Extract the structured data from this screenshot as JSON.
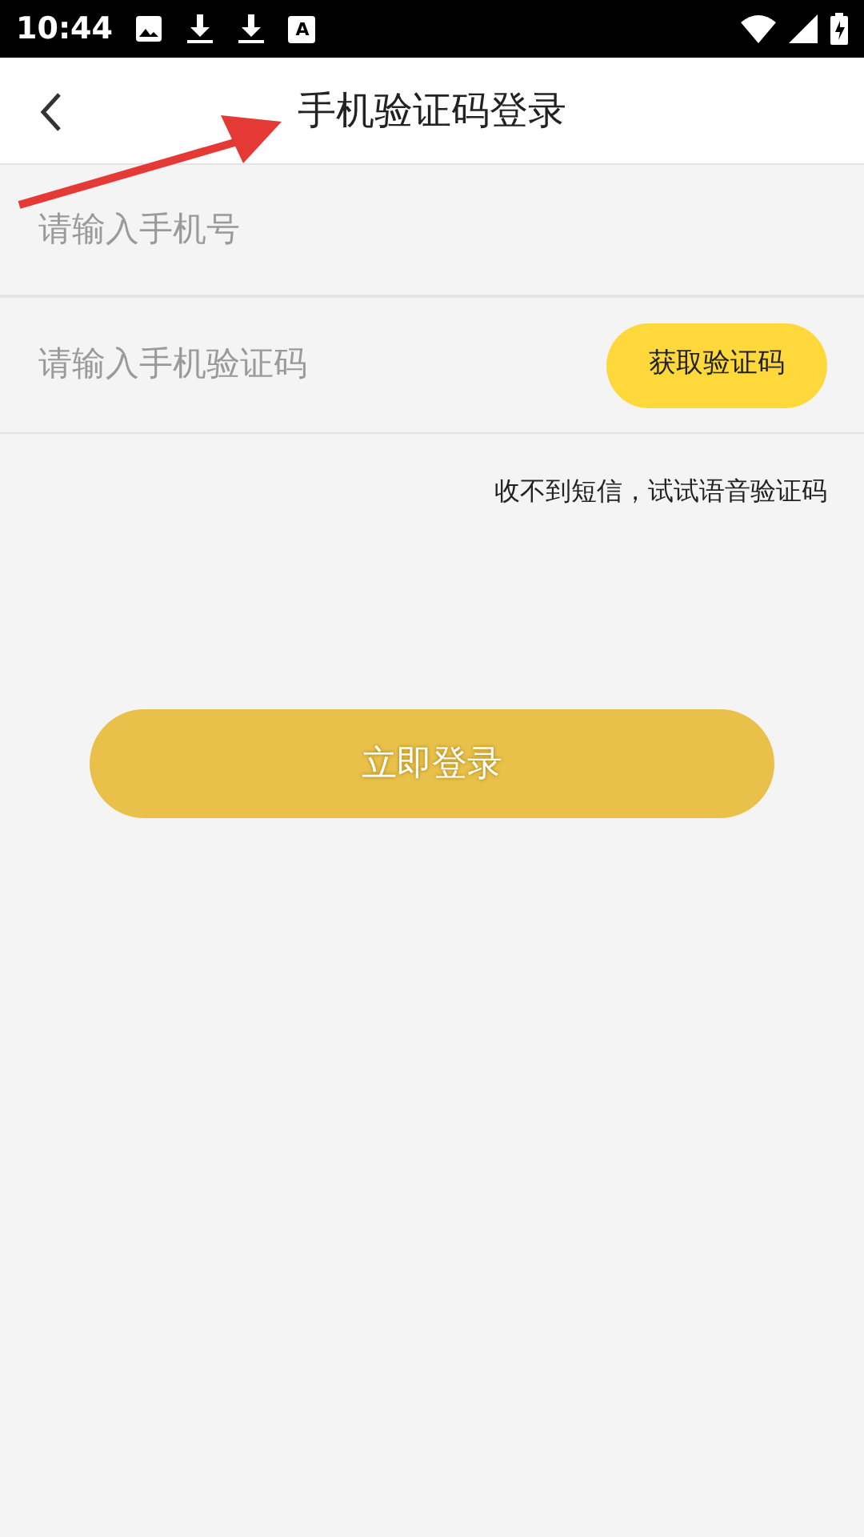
{
  "status_bar": {
    "time": "10:44",
    "badge_letter": "A"
  },
  "header": {
    "title": "手机验证码登录"
  },
  "phone_field": {
    "placeholder": "请输入手机号"
  },
  "code_field": {
    "placeholder": "请输入手机验证码"
  },
  "get_code_button": "获取验证码",
  "voice_code_link": "收不到短信，试试语音验证码",
  "login_button": {
    "label": "立即登录",
    "disabled": true
  }
}
